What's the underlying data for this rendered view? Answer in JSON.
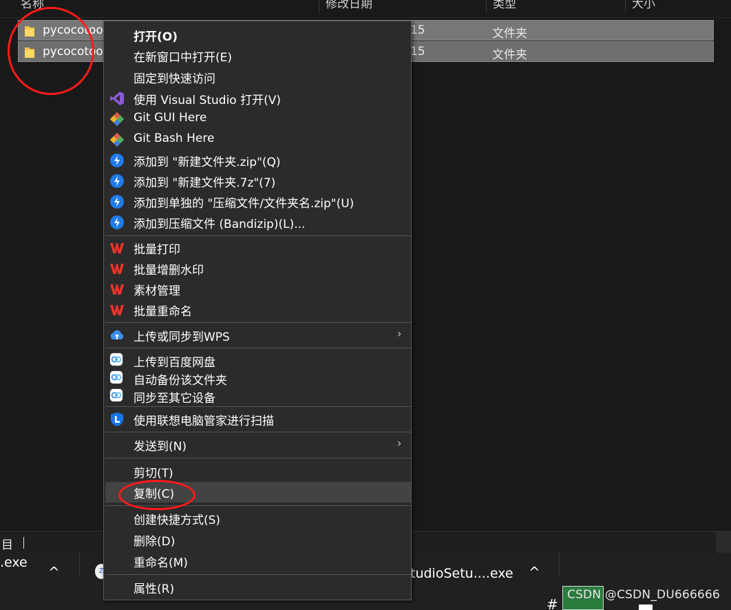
{
  "explorer": {
    "columns": [
      "名称",
      "修改日期",
      "类型",
      "大小"
    ],
    "rows": [
      {
        "name": "pycocotools",
        "date": "15",
        "type": "文件夹"
      },
      {
        "name": "pycocotools",
        "date": "15",
        "type": "文件夹"
      }
    ],
    "status": "目"
  },
  "context_menu": {
    "items": [
      {
        "label": "打开(O)",
        "icon": "none"
      },
      {
        "label": "在新窗口中打开(E)",
        "icon": "none"
      },
      {
        "label": "固定到快速访问",
        "icon": "none"
      },
      {
        "label": "使用 Visual Studio 打开(V)",
        "icon": "visual-studio-icon"
      },
      {
        "label": "Git GUI Here",
        "icon": "git-icon"
      },
      {
        "label": "Git Bash Here",
        "icon": "git-icon"
      },
      {
        "label": "添加到 \"新建文件夹.zip\"(Q)",
        "icon": "bandizip-icon"
      },
      {
        "label": "添加到 \"新建文件夹.7z\"(7)",
        "icon": "bandizip-icon"
      },
      {
        "label": "添加到单独的 \"压缩文件/文件夹名.zip\"(U)",
        "icon": "bandizip-icon"
      },
      {
        "label": "添加到压缩文件 (Bandizip)(L)...",
        "icon": "bandizip-icon"
      },
      {
        "label": "批量打印",
        "icon": "wps-icon"
      },
      {
        "label": "批量增删水印",
        "icon": "wps-icon"
      },
      {
        "label": "素材管理",
        "icon": "wps-icon"
      },
      {
        "label": "批量重命名",
        "icon": "wps-icon"
      },
      {
        "label": "上传或同步到WPS",
        "icon": "wps-cloud-icon",
        "submenu": "›"
      },
      {
        "label": "上传到百度网盘",
        "icon": "baidu-netdisk-icon"
      },
      {
        "label": "自动备份该文件夹",
        "icon": "baidu-netdisk-icon"
      },
      {
        "label": "同步至其它设备",
        "icon": "baidu-netdisk-icon"
      },
      {
        "label": "使用联想电脑管家进行扫描",
        "icon": "lenovo-shield-icon"
      },
      {
        "label": "发送到(N)",
        "icon": "none",
        "submenu": "›"
      },
      {
        "label": "剪切(T)",
        "icon": "none"
      },
      {
        "label": "复制(C)",
        "icon": "none",
        "highlighted": true
      },
      {
        "label": "创建快捷方式(S)",
        "icon": "none"
      },
      {
        "label": "删除(D)",
        "icon": "none"
      },
      {
        "label": "重命名(M)",
        "icon": "none"
      },
      {
        "label": "属性(R)",
        "icon": "none"
      }
    ]
  },
  "taskbar": {
    "left_item": ".exe",
    "caret_up": "^",
    "zip_badge": "Z",
    "middle_item": "tudioSetu....exe",
    "watermark": "CSDN @CSDN_DU666666",
    "tray_hash": "#"
  },
  "colors": {
    "menu_bg": "#2b2b2b",
    "highlight": "#434343",
    "annotation": "#ff1a1a",
    "wps_red": "#e8352c",
    "bandizip_blue": "#1f7be8"
  }
}
